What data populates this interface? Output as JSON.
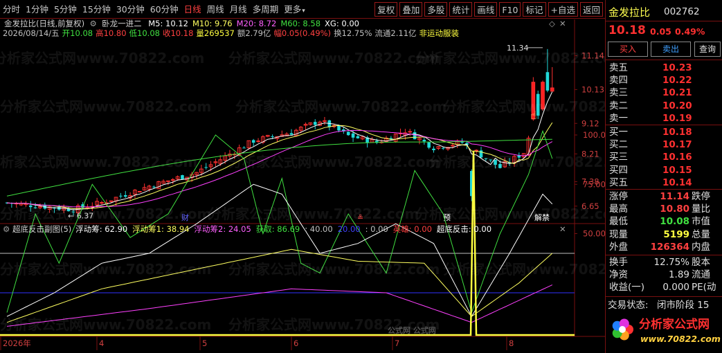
{
  "toolbar": {
    "left": [
      "分时",
      "1分钟",
      "5分钟",
      "15分钟",
      "30分钟",
      "60分钟",
      "日线",
      "周线",
      "月线",
      "多周期",
      "更多"
    ],
    "more_arrow": "▾",
    "right": [
      "复权",
      "叠加",
      "多股",
      "统计",
      "画线",
      "F10",
      "标记",
      "+自选",
      "返回"
    ],
    "active": "日线"
  },
  "main_chart": {
    "title": "金发拉比(日线,前复权)",
    "indicator": "卧龙一进二",
    "ma": [
      {
        "label": "M5: 10.12",
        "color": "#ffffff"
      },
      {
        "label": "M10: 9.76",
        "color": "#ffff60"
      },
      {
        "label": "M20: 8.72",
        "color": "#ff60ff"
      },
      {
        "label": "M60: 8.58",
        "color": "#40e040"
      },
      {
        "label": "XG: 0.00",
        "color": "#ffffff"
      }
    ],
    "info": [
      {
        "t": "2026/08/14/五",
        "c": "#c0c0c0"
      },
      {
        "t": "开10.08",
        "c": "#40e040"
      },
      {
        "t": "高10.80",
        "c": "#ff4040"
      },
      {
        "t": "低10.08",
        "c": "#40e040"
      },
      {
        "t": "收10.18",
        "c": "#ff4040"
      },
      {
        "t": "量269537",
        "c": "#ffff40"
      },
      {
        "t": "额2.79亿",
        "c": "#c0c0c0"
      },
      {
        "t": "幅0.05(0.49%)",
        "c": "#ff4040"
      },
      {
        "t": "换12.75%",
        "c": "#c0c0c0"
      },
      {
        "t": "流通2.11亿",
        "c": "#c0c0c0"
      },
      {
        "t": "非运动服装",
        "c": "#ffff40"
      }
    ],
    "y_ticks": [
      "11.14",
      "10.13",
      "9.12",
      "8.21",
      "7.38",
      "6.65"
    ],
    "high_label": "11.34",
    "low_label": "6.37",
    "events": [
      {
        "t": "财",
        "c": "#6060ff"
      },
      {
        "t": "≗",
        "c": "#ff4040"
      },
      {
        "t": "预",
        "c": "#ffffff"
      },
      {
        "t": "解禁",
        "c": "#ffffff"
      }
    ]
  },
  "sub_chart": {
    "title": "超底反击副图(5)",
    "values": [
      {
        "t": "浮动筹: 62.90",
        "c": "#ffffff"
      },
      {
        "t": "浮动筹1: 38.94",
        "c": "#ffff60"
      },
      {
        "t": "浮动筹2: 24.05",
        "c": "#ff60ff"
      },
      {
        "t": "获取: 86.69",
        "c": "#40e040"
      },
      {
        "t": ": 40.00",
        "c": "#c0c0c0"
      },
      {
        "t": "20.00",
        "c": "#4040ff"
      },
      {
        "t": ": 0.00",
        "c": "#c0c0c0"
      },
      {
        "t": "英雄: 0.00",
        "c": "#ff4040"
      },
      {
        "t": "超底反击: 0.00",
        "c": "#ffffff"
      }
    ],
    "y_ticks": [
      "100.0",
      "75.00",
      "50.00"
    ]
  },
  "x_axis": [
    "2026年",
    "4",
    "5",
    "6",
    "7",
    "8"
  ],
  "watermark": "分析家公式网www.70822.com",
  "watermark2": "公式网  公式网",
  "quote": {
    "name": "金发拉比",
    "code": "002762",
    "price": "10.18",
    "change": "0.05",
    "pct": "0.49%",
    "buttons": [
      "买入",
      "卖出",
      "查询"
    ],
    "asks": [
      {
        "label": "卖五",
        "price": "10.23"
      },
      {
        "label": "卖四",
        "price": "10.22"
      },
      {
        "label": "卖三",
        "price": "10.21"
      },
      {
        "label": "卖二",
        "price": "10.20"
      },
      {
        "label": "卖一",
        "price": "10.19"
      }
    ],
    "bids": [
      {
        "label": "买一",
        "price": "10.18"
      },
      {
        "label": "买二",
        "price": "10.17"
      },
      {
        "label": "买三",
        "price": "10.16"
      },
      {
        "label": "买四",
        "price": "10.15"
      },
      {
        "label": "买五",
        "price": "10.14"
      }
    ],
    "stats": [
      {
        "l": "涨停",
        "v": "11.14",
        "r": "跌停",
        "vc": "#ff4040"
      },
      {
        "l": "最高",
        "v": "10.80",
        "r": "量比",
        "vc": "#ff4040"
      },
      {
        "l": "最低",
        "v": "10.08",
        "r": "市值",
        "vc": "#40e040"
      },
      {
        "l": "现量",
        "v": "5199",
        "r": "总量",
        "vc": "#ffff40"
      },
      {
        "l": "外盘",
        "v": "126364",
        "r": "内盘",
        "vc": "#ff4040"
      }
    ],
    "stats2": [
      {
        "l": "换手",
        "v": "12.75%",
        "r": "股本"
      },
      {
        "l": "净资",
        "v": "1.89",
        "r": "流通"
      },
      {
        "l": "收益(一)",
        "v": "0.000",
        "r": "PE(动"
      }
    ],
    "status_label": "交易状态:",
    "status_value": "闭市阶段 15"
  },
  "logo": {
    "title": "分析家公式网",
    "url": "www.70822.com"
  },
  "colors": {
    "up": "#ff3030",
    "down": "#20d8d8",
    "border": "#7a1010",
    "ma5": "#ffffff",
    "ma10": "#ffff60",
    "ma20": "#ff40ff",
    "ma60": "#40e040"
  }
}
